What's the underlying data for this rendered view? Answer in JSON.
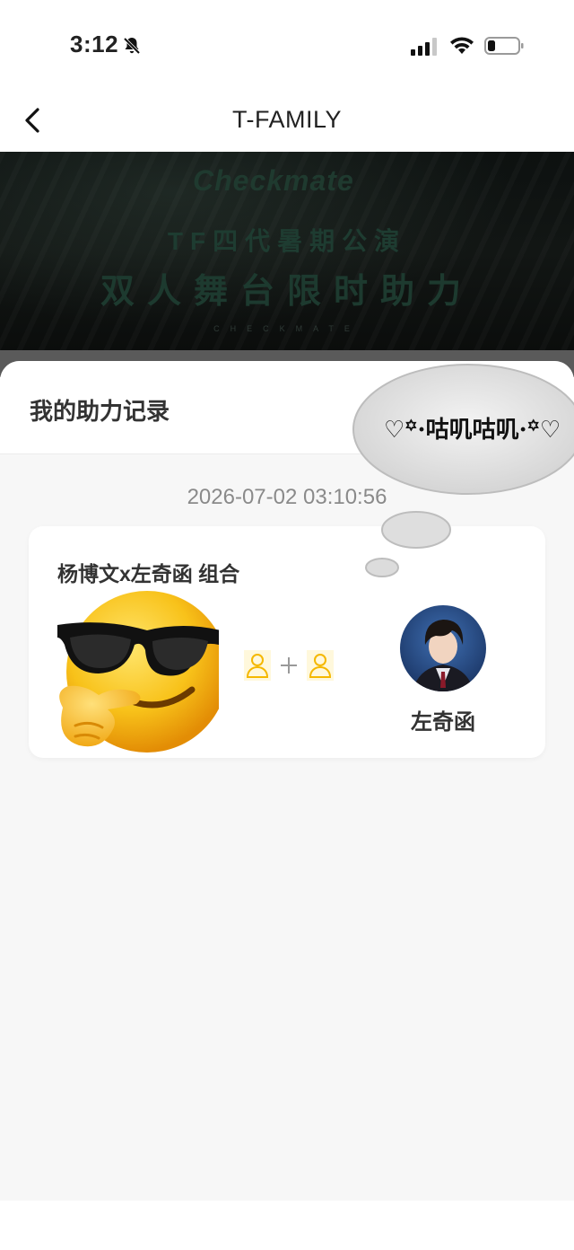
{
  "status": {
    "time": "3:12"
  },
  "nav": {
    "title": "T-FAMILY"
  },
  "banner": {
    "brand": "Checkmate",
    "line1": "TF四代暑期公演",
    "line2": "双人舞台限时助力",
    "sub": "CHECKMATE"
  },
  "sheet": {
    "title": "我的助力记录",
    "record_time": "2026-07-02 03:10:56",
    "card": {
      "group_title": "杨博文x左奇函 组合",
      "member_name": "左奇函"
    }
  },
  "sticker": {
    "text": "♡꙳·咕叽咕叽·꙳♡"
  },
  "colors": {
    "accent": "#f5b800",
    "sheet_bg": "#f7f7f7"
  },
  "icons": [
    "back-icon",
    "bell-slash-icon",
    "signal-icon",
    "wifi-icon",
    "battery-icon",
    "person-icon",
    "plus-icon",
    "sunglasses-emoji"
  ]
}
